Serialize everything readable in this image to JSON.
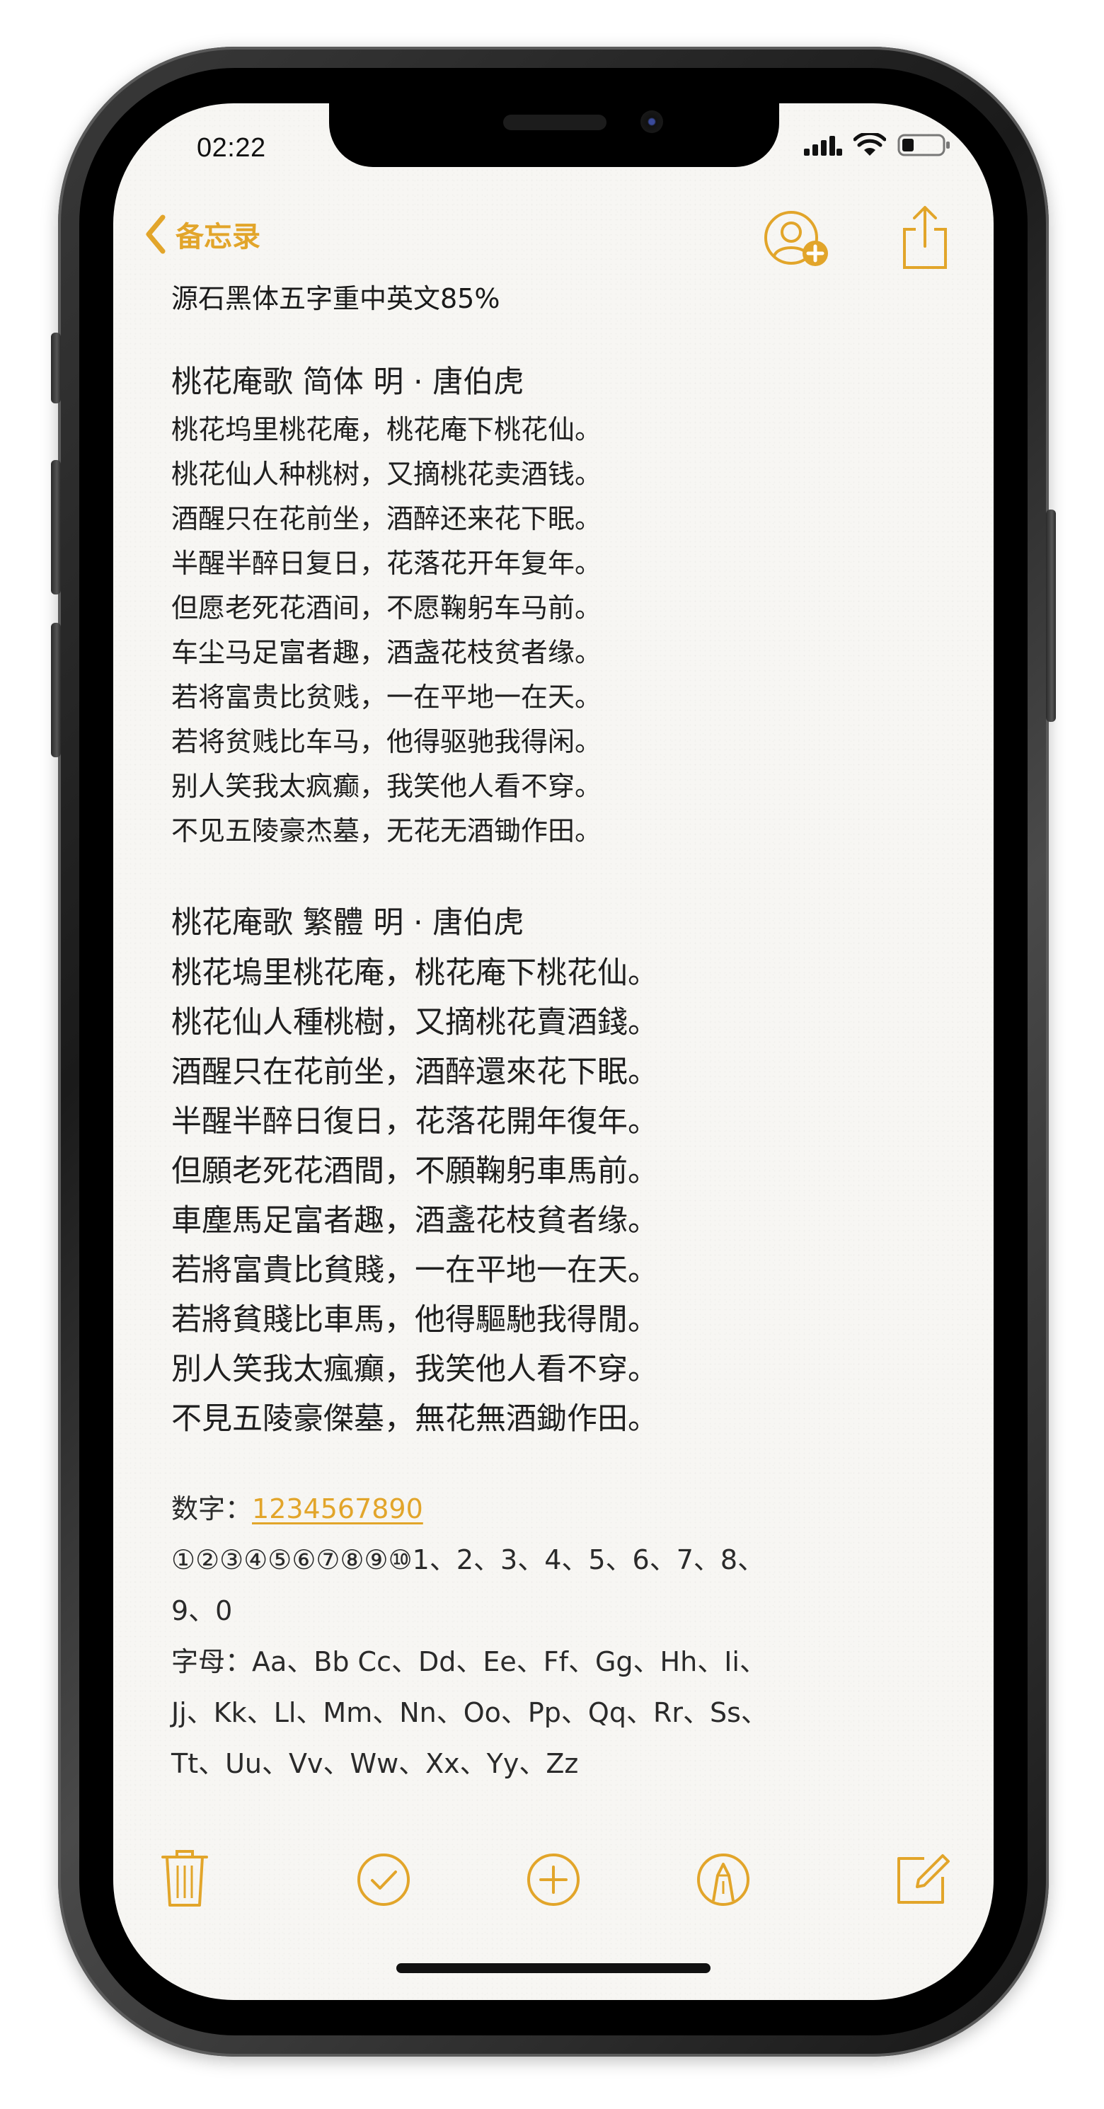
{
  "status_bar": {
    "time": "02:22",
    "icons": [
      "cellular-signal-icon",
      "wifi-icon",
      "battery-icon"
    ]
  },
  "nav": {
    "back_label": "备忘录",
    "back_icon": "chevron-left-icon",
    "add_person_icon": "add-person-icon",
    "share_icon": "share-icon"
  },
  "note": {
    "font_line": "源石黑体五字重中英文85%",
    "poem_simplified": {
      "title": "桃花庵歌   简体    明 · 唐伯虎",
      "lines": [
        "桃花坞里桃花庵，桃花庵下桃花仙。",
        "桃花仙人种桃树，又摘桃花卖酒钱。",
        "酒醒只在花前坐，酒醉还来花下眠。",
        "半醒半醉日复日，花落花开年复年。",
        "但愿老死花酒间，不愿鞠躬车马前。",
        "车尘马足富者趣，酒盏花枝贫者缘。",
        "若将富贵比贫贱，一在平地一在天。",
        "若将贫贱比车马，他得驱驰我得闲。",
        "别人笑我太疯癫，我笑他人看不穿。",
        "不见五陵豪杰墓，无花无酒锄作田。"
      ]
    },
    "poem_traditional": {
      "title": "桃花庵歌   繁體        明 · 唐伯虎",
      "lines": [
        "桃花塢里桃花庵，桃花庵下桃花仙。",
        "桃花仙人種桃樹，又摘桃花賣酒錢。",
        "酒醒只在花前坐，酒醉還來花下眠。",
        "半醒半醉日復日，花落花開年復年。",
        "但願老死花酒間，不願鞠躬車馬前。",
        "車塵馬足富者趣，酒盞花枝貧者缘。",
        "若將富貴比貧賤，一在平地一在天。",
        "若將貧賤比車馬，他得驅馳我得閒。",
        "別人笑我太瘋癲，我笑他人看不穿。",
        "不見五陵豪傑墓，無花無酒鋤作田。"
      ]
    },
    "numbers_label": "数字：",
    "numbers_link": "1234567890",
    "numbers_line1": "①②③④⑤⑥⑦⑧⑨⑩1、2、3、4、5、6、7、8、",
    "numbers_line2": "9、0",
    "letters_line1": "字母：Aa、Bb Cc、Dd、Ee、Ff、Gg、Hh、Ii、",
    "letters_line2": "Jj、Kk、Ll、Mm、Nn、Oo、Pp、Qq、Rr、Ss、",
    "letters_line3": "Tt、Uu、Vv、Ww、Xx、Yy、Zz"
  },
  "toolbar": {
    "icons": [
      "trash-icon",
      "checklist-icon",
      "add-icon",
      "markup-icon",
      "compose-icon"
    ]
  },
  "colors": {
    "accent": "#e2a52a",
    "paper": "#f7f6f3",
    "text": "#1f1f1f"
  }
}
